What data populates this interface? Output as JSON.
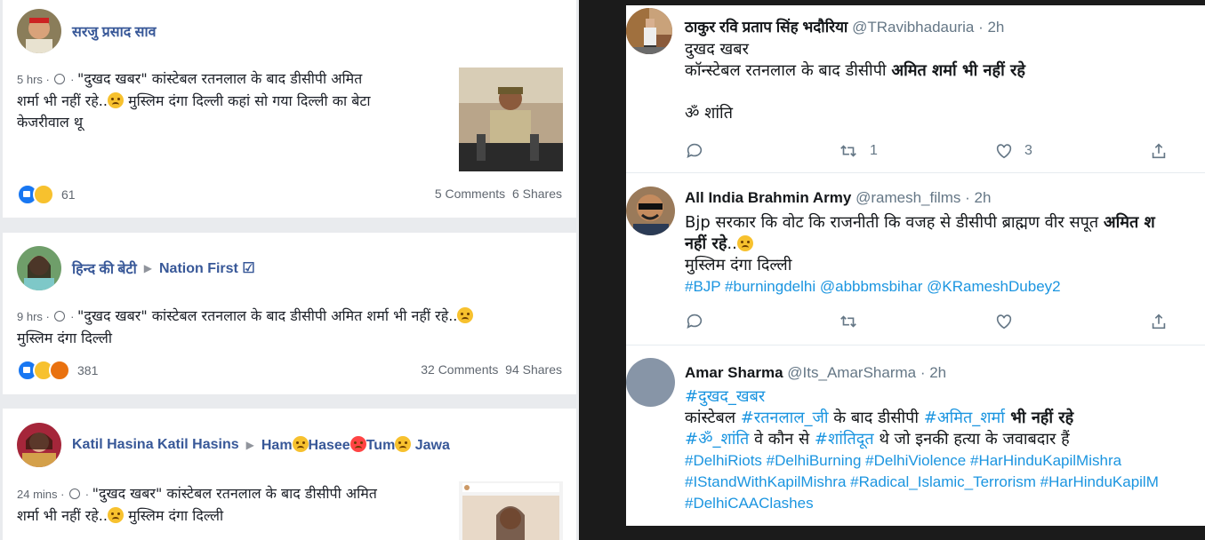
{
  "facebook": {
    "posts": [
      {
        "author": "सरजु प्रसाद साव",
        "time": "5 hrs",
        "text_line1": "\"दुखद खबर\" कांस्टेबल रतनलाल के बाद डीसीपी अमित",
        "text_line2": "शर्मा भी नहीं रहे..",
        "text_line2b": " मुस्लिम दंगा दिल्ली कहां सो गया दिल्ली का बेटा",
        "text_line3": "केजरीवाल थू",
        "reactions": "61",
        "comments": "5 Comments",
        "shares": "6 Shares"
      },
      {
        "author": "हिन्द की बेटी",
        "page": "Nation First ☑",
        "time": "9 hrs",
        "text_line1": "\"दुखद खबर\" कांस्टेबल रतनलाल के बाद डीसीपी अमित शर्मा भी नहीं रहे..",
        "text_line2": "मुस्लिम दंगा दिल्ली",
        "reactions": "381",
        "comments": "32 Comments",
        "shares": "94 Shares"
      },
      {
        "author": "Katil Hasina Katil Hasins",
        "page_a": "Ham",
        "page_b": "Hasee",
        "page_c": "Tum",
        "page_d": "Jawa",
        "time": "24 mins",
        "text_line1": "\"दुखद खबर\" कांस्टेबल रतनलाल के बाद डीसीपी अमित",
        "text_line2": "शर्मा भी नहीं रहे..",
        "text_line2b": " मुस्लिम दंगा दिल्ली"
      }
    ]
  },
  "twitter": {
    "tweets": [
      {
        "name": "ठाकुर रवि प्रताप सिंह भदौरिया",
        "handle": "@TRavibhadauria · 2h",
        "l1": "दुखद खबर",
        "l2a": "कॉन्स्टेबल रतनलाल के बाद डीसीपी ",
        "l2b": "अमित शर्मा भी नहीं रहे",
        "l3": "ॐ शांति",
        "retweets": "1",
        "likes": "3"
      },
      {
        "name": "All India Brahmin Army",
        "handle": "@ramesh_films · 2h",
        "l1a": "Bjp सरकार कि वोट कि राजनीती कि वजह से डीसीपी ब्राह्मण वीर सपूत ",
        "l1b": "अमित श",
        "l2": "नहीं रहे",
        "l2c": "..",
        "l3": "मुस्लिम दंगा दिल्ली",
        "l4": "#BJP #burningdelhi @abbbmsbihar @KRameshDubey2"
      },
      {
        "name": "Amar Sharma",
        "handle": "@Its_AmarSharma · 2h",
        "l1": "#दुखद_खबर",
        "l2a": "कांस्टेबल ",
        "l2b": "#रतनलाल_जी",
        "l2c": " के बाद डीसीपी ",
        "l2d": "#अमित_शर्मा",
        "l2e": " भी नहीं रहे",
        "l3a": "#ॐ_शांति",
        "l3b": " वे कौन से ",
        "l3c": "#शांतिदूत",
        "l3d": " थे जो इनकी हत्या के जवाबदार हैं",
        "l4": "#DelhiRiots #DelhiBurning #DelhiViolence #HarHinduKapilMishra",
        "l5": "#IStandWithKapilMishra #Radical_Islamic_Terrorism #HarHinduKapilM",
        "l6": "#DelhiCAAClashes"
      }
    ]
  },
  "colors": {
    "fb_link": "#385898",
    "tw_link": "#1b95e0",
    "fb_bg": "#e9ebee",
    "divider": "#1b1b1b"
  }
}
